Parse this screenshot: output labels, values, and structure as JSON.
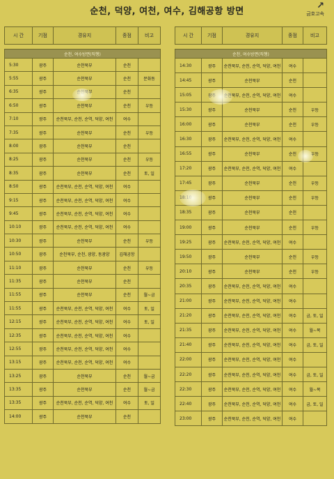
{
  "title": "순천, 덕양, 여천, 여수, 김해공항 방면",
  "logo": "금호고속",
  "headers": [
    "시 간",
    "기점",
    "경유지",
    "종점",
    "비고"
  ],
  "left": {
    "subheader": "순천, 여수방면(직행)",
    "rows": [
      [
        "5:30",
        "광주",
        "순천북부",
        "순천",
        ""
      ],
      [
        "5:55",
        "광주",
        "순천북부",
        "순천",
        "문화동"
      ],
      [
        "6:35",
        "광주",
        "순천북부",
        "순천",
        ""
      ],
      [
        "6:50",
        "광주",
        "순천북부",
        "순천",
        "우등"
      ],
      [
        "7:10",
        "광주",
        "순천북부, 순천, 순역, 덕양, 여천",
        "여수",
        ""
      ],
      [
        "7:35",
        "광주",
        "순천북부",
        "순천",
        "우등"
      ],
      [
        "8:00",
        "광주",
        "순천북부",
        "순천",
        ""
      ],
      [
        "8:25",
        "광주",
        "순천북부",
        "순천",
        "우등"
      ],
      [
        "8:35",
        "광주",
        "순천북부",
        "순천",
        "토, 일"
      ],
      [
        "8:50",
        "광주",
        "순천북부, 순천, 순역, 덕양, 여천",
        "여수",
        ""
      ],
      [
        "9:15",
        "광주",
        "순천북부, 순천, 순역, 덕양, 여천",
        "여수",
        ""
      ],
      [
        "9:45",
        "광주",
        "순천북부, 순천, 순역, 덕양, 여천",
        "여수",
        ""
      ],
      [
        "10:10",
        "광주",
        "순천북부, 순천, 순역, 덕양, 여천",
        "여수",
        ""
      ],
      [
        "10:30",
        "광주",
        "순천북부",
        "순천",
        "우등"
      ],
      [
        "10:50",
        "광주",
        "순천북부, 순천, 광양, 동광양",
        "김해공항",
        ""
      ],
      [
        "11:10",
        "광주",
        "순천북부",
        "순천",
        "우등"
      ],
      [
        "11:35",
        "광주",
        "순천북부",
        "순천",
        ""
      ],
      [
        "11:55",
        "광주",
        "순천북부",
        "순천",
        "월~금"
      ],
      [
        "11:55",
        "광주",
        "순천북부, 순천, 순역, 덕양, 여천",
        "여수",
        "토, 일"
      ],
      [
        "12:15",
        "광주",
        "순천북부, 순천, 순역, 덕양, 여천",
        "여수",
        "토, 일"
      ],
      [
        "12:35",
        "광주",
        "순천북부, 순천, 순역, 덕양, 여천",
        "여수",
        ""
      ],
      [
        "12:55",
        "광주",
        "순천북부, 순천, 순역, 덕양, 여천",
        "여수",
        ""
      ],
      [
        "13:15",
        "광주",
        "순천북부, 순천, 순역, 덕양, 여천",
        "여수",
        ""
      ],
      [
        "13:25",
        "광주",
        "순천북부",
        "순천",
        "월~금"
      ],
      [
        "13:35",
        "광주",
        "순천북부",
        "순천",
        "월~금"
      ],
      [
        "13:35",
        "광주",
        "순천북부, 순천, 순역, 덕양, 여천",
        "여수",
        "토, 일"
      ],
      [
        "14:00",
        "광주",
        "순천북부",
        "순천",
        ""
      ]
    ]
  },
  "right": {
    "subheader": "순천, 여수방면(직행)",
    "rows": [
      [
        "14:30",
        "광주",
        "순천북부, 순천, 순역, 덕양, 여천",
        "여수",
        ""
      ],
      [
        "14:45",
        "광주",
        "순천북부",
        "순천",
        ""
      ],
      [
        "15:05",
        "광주",
        "순천북부, 순천, 순역, 덕양, 여천",
        "여수",
        ""
      ],
      [
        "15:30",
        "광주",
        "순천북부",
        "순천",
        "우등"
      ],
      [
        "16:00",
        "광주",
        "순천북부",
        "순천",
        "우등"
      ],
      [
        "16:30",
        "광주",
        "순천북부, 순천, 순역, 덕양, 여천",
        "여수",
        ""
      ],
      [
        "16:55",
        "광주",
        "순천북부",
        "순천",
        "우등"
      ],
      [
        "17:20",
        "광주",
        "순천북부, 순천, 순역, 덕양, 여천",
        "여수",
        ""
      ],
      [
        "17:45",
        "광주",
        "순천북부",
        "순천",
        "우등"
      ],
      [
        "18:10",
        "광주",
        "순천북부",
        "순천",
        "우등"
      ],
      [
        "18:35",
        "광주",
        "순천북부",
        "순천",
        ""
      ],
      [
        "19:00",
        "광주",
        "순천북부",
        "순천",
        "우등"
      ],
      [
        "19:25",
        "광주",
        "순천북부, 순천, 순역, 덕양, 여천",
        "여수",
        ""
      ],
      [
        "19:50",
        "광주",
        "순천북부",
        "순천",
        "우등"
      ],
      [
        "20:10",
        "광주",
        "순천북부",
        "순천",
        "우등"
      ],
      [
        "20:35",
        "광주",
        "순천북부, 순천, 순역, 덕양, 여천",
        "여수",
        ""
      ],
      [
        "21:00",
        "광주",
        "순천북부, 순천, 순역, 덕양, 여천",
        "여수",
        ""
      ],
      [
        "21:20",
        "광주",
        "순천북부, 순천, 순역, 덕양, 여천",
        "여수",
        "금, 토, 일"
      ],
      [
        "21:35",
        "광주",
        "순천북부, 순천, 순역, 덕양, 여천",
        "여수",
        "월~목"
      ],
      [
        "21:40",
        "광주",
        "순천북부, 순천, 순역, 덕양, 여천",
        "여수",
        "금, 토, 일"
      ],
      [
        "22:00",
        "광주",
        "순천북부, 순천, 순역, 덕양, 여천",
        "여수",
        ""
      ],
      [
        "22:20",
        "광주",
        "순천북부, 순천, 순역, 덕양, 여천",
        "여수",
        "금, 토, 일"
      ],
      [
        "22:30",
        "광주",
        "순천북부, 순천, 순역, 덕양, 여천",
        "여수",
        "월~목"
      ],
      [
        "22:40",
        "광주",
        "순천북부, 순천, 순역, 덕양, 여천",
        "여수",
        "금, 토, 일"
      ],
      [
        "23:00",
        "광주",
        "순천북부, 순천, 순역, 덕양, 여천",
        "여수",
        ""
      ]
    ]
  }
}
